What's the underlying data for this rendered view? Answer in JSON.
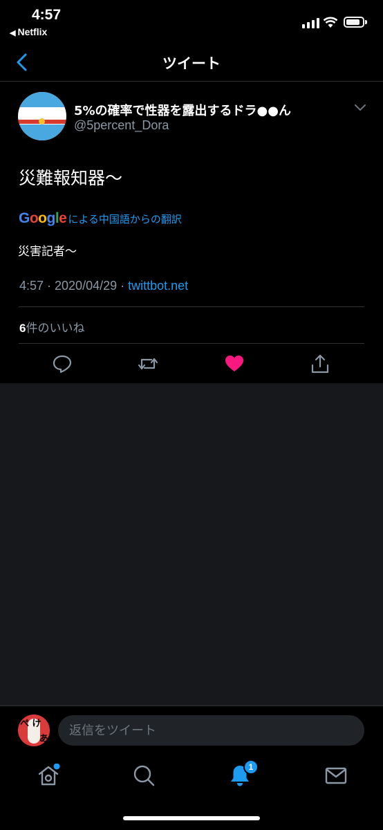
{
  "status_bar": {
    "time": "4:57",
    "back_app": "Netflix",
    "back_icon": "back-triangle-icon"
  },
  "nav": {
    "title": "ツイート",
    "back_icon": "chevron-left-icon"
  },
  "tweet": {
    "display_name": "5%の確率で性器を露出するドラ●●ん",
    "handle": "@5percent_Dora",
    "text": "災難報知器〜",
    "translate_brand": "Google",
    "translate_label": "による中国語からの翻訳",
    "translated_text": "災害記者〜",
    "timestamp": "4:57 · 2020/04/29 · ",
    "source": "twittbot.net",
    "like_count": "6",
    "like_label": "件のいいね",
    "actions": [
      "reply-icon",
      "retweet-icon",
      "heart-icon",
      "share-icon"
    ],
    "liked": true
  },
  "reply": {
    "placeholder": "返信をツイート",
    "avatar_text_1": "ぺ け",
    "avatar_text_2": "あ と"
  },
  "tabbar": {
    "items": [
      "home-icon",
      "search-icon",
      "notifications-icon",
      "messages-icon"
    ],
    "notification_badge": "1"
  },
  "colors": {
    "background": "#000000",
    "accent": "#1d9bf0",
    "like": "#f91880",
    "secondary_text": "#8b98a5",
    "empty_area": "#16181c"
  }
}
